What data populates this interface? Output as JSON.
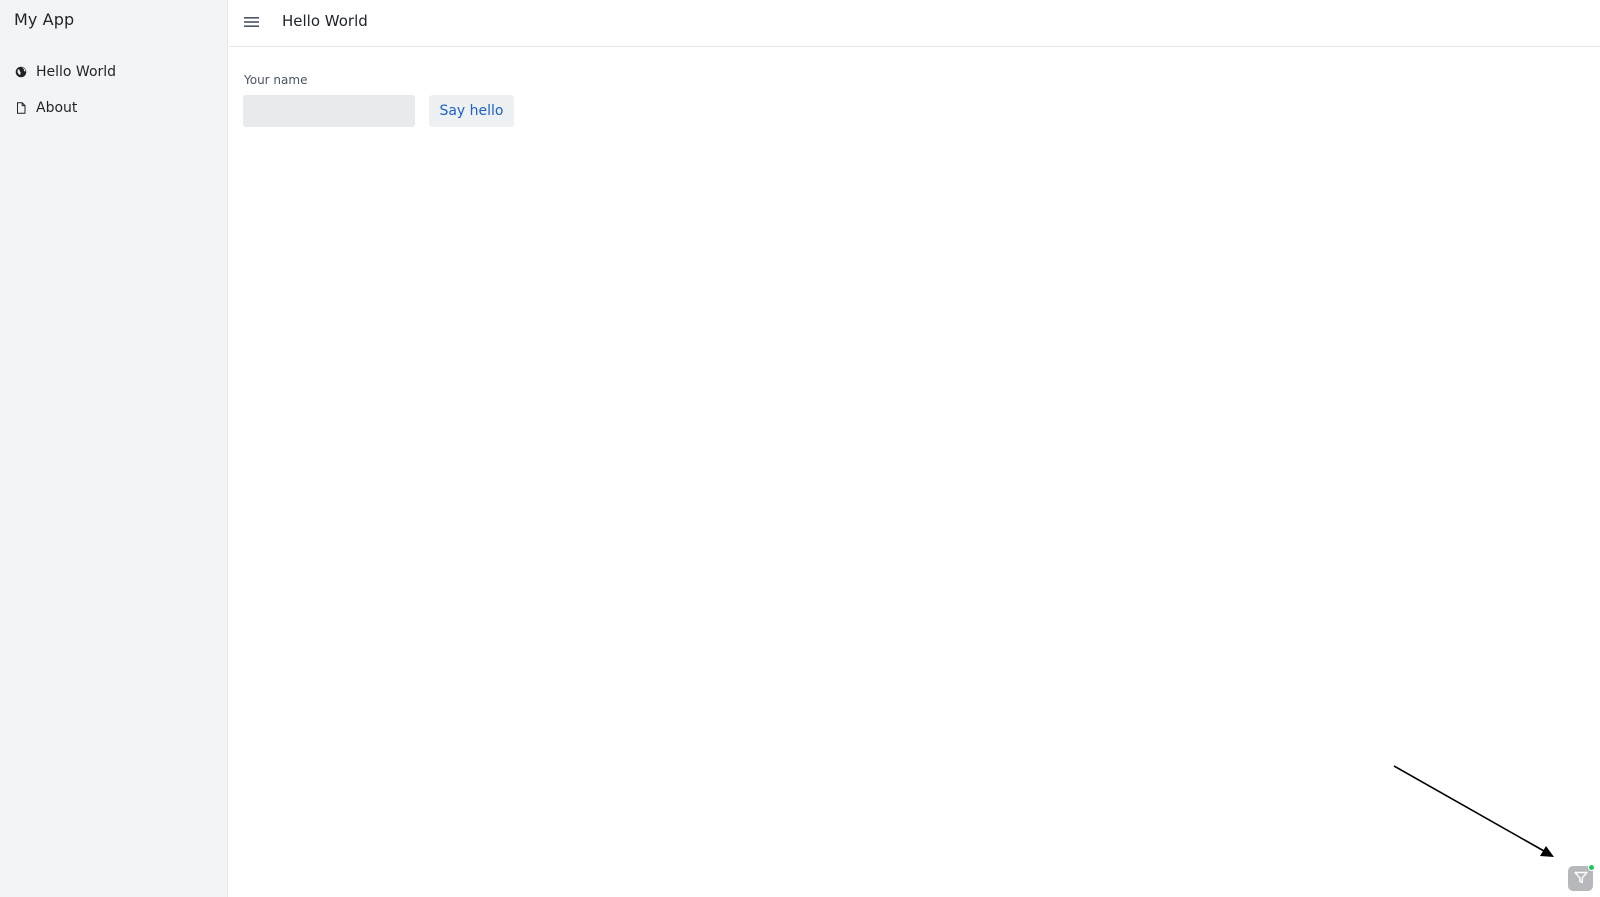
{
  "sidebar": {
    "app_title": "My App",
    "items": [
      {
        "label": "Hello World",
        "icon": "globe-icon"
      },
      {
        "label": "About",
        "icon": "file-icon"
      }
    ]
  },
  "header": {
    "menu_icon": "hamburger-menu-icon",
    "title": "Hello World"
  },
  "form": {
    "name_label": "Your name",
    "name_value": "",
    "name_placeholder": "",
    "submit_label": "Say hello"
  },
  "corner_widget": {
    "icon": "funnel-icon",
    "status_color": "#22c55e"
  },
  "colors": {
    "sidebar_bg": "#f3f4f6",
    "accent": "#1d5fc7",
    "input_bg": "#e8ebee"
  }
}
